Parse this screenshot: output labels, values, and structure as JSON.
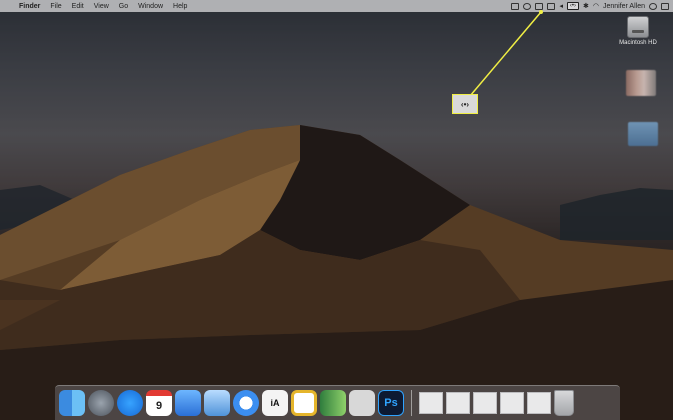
{
  "menubar": {
    "app_name": "Finder",
    "menus": [
      "File",
      "Edit",
      "View",
      "Go",
      "Window",
      "Help"
    ],
    "user_name": "Jennifer Allen",
    "status_icons": [
      "dropbox-icon",
      "screen-record-icon",
      "cast-icon",
      "mail-icon",
      "volume-icon",
      "menu-sync-icon",
      "bluetooth-icon",
      "wifi-icon",
      "search-icon",
      "control-center-icon"
    ],
    "sync_glyph": "‹•›"
  },
  "callout": {
    "glyph": "‹•›",
    "color": "#f0ee44"
  },
  "desktop": {
    "hd_label": "Macintosh HD"
  },
  "dock": {
    "apps": [
      {
        "name": "finder-icon",
        "label": ""
      },
      {
        "name": "launchpad-icon",
        "label": ""
      },
      {
        "name": "app-store-icon",
        "label": ""
      },
      {
        "name": "calendar-icon",
        "label": "9"
      },
      {
        "name": "mail-app-icon",
        "label": ""
      },
      {
        "name": "preview-icon",
        "label": ""
      },
      {
        "name": "safari-icon",
        "label": ""
      },
      {
        "name": "ia-writer-icon",
        "label": "iA"
      },
      {
        "name": "slack-icon",
        "label": ""
      },
      {
        "name": "kindle-icon",
        "label": ""
      },
      {
        "name": "script-editor-icon",
        "label": ""
      },
      {
        "name": "photoshop-icon",
        "label": "Ps"
      }
    ]
  }
}
